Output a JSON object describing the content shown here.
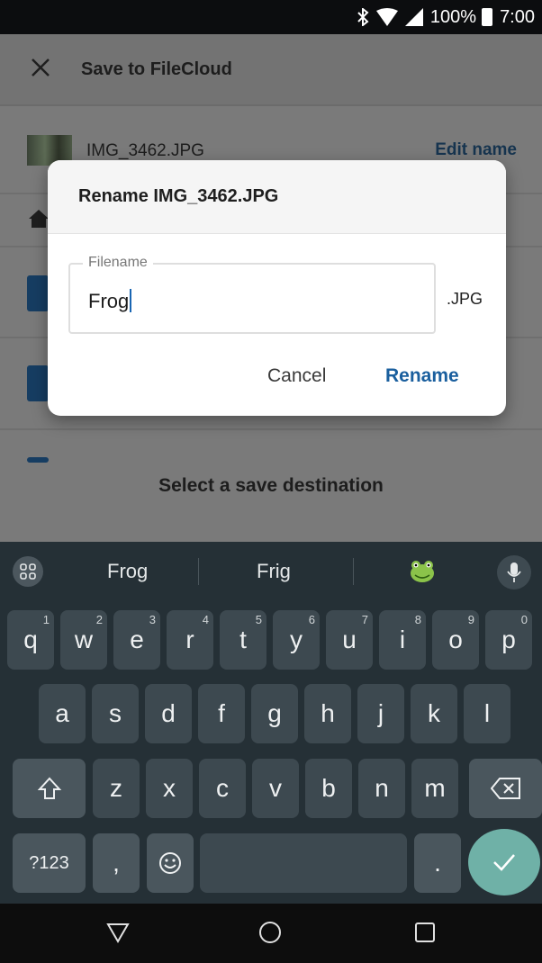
{
  "status_bar": {
    "battery": "100%",
    "time": "7:00"
  },
  "header": {
    "title": "Save to FileCloud"
  },
  "file": {
    "name": "IMG_3462.JPG",
    "edit_label": "Edit name"
  },
  "destination_hint": "Select a save destination",
  "dialog": {
    "title": "Rename IMG_3462.JPG",
    "field_label": "Filename",
    "field_value": "Frog",
    "extension": ".JPG",
    "cancel_label": "Cancel",
    "rename_label": "Rename"
  },
  "keyboard": {
    "suggestions": [
      "Frog",
      "Frig"
    ],
    "row1": [
      {
        "key": "q",
        "hint": "1"
      },
      {
        "key": "w",
        "hint": "2"
      },
      {
        "key": "e",
        "hint": "3"
      },
      {
        "key": "r",
        "hint": "4"
      },
      {
        "key": "t",
        "hint": "5"
      },
      {
        "key": "y",
        "hint": "6"
      },
      {
        "key": "u",
        "hint": "7"
      },
      {
        "key": "i",
        "hint": "8"
      },
      {
        "key": "o",
        "hint": "9"
      },
      {
        "key": "p",
        "hint": "0"
      }
    ],
    "row2": [
      "a",
      "s",
      "d",
      "f",
      "g",
      "h",
      "j",
      "k",
      "l"
    ],
    "row3": [
      "z",
      "x",
      "c",
      "v",
      "b",
      "n",
      "m"
    ],
    "symbols_label": "?123",
    "comma": ",",
    "period": "."
  },
  "colors": {
    "accent": "#1a5f9e",
    "enter_key": "#6fb1a7",
    "keyboard_bg": "#253036"
  }
}
